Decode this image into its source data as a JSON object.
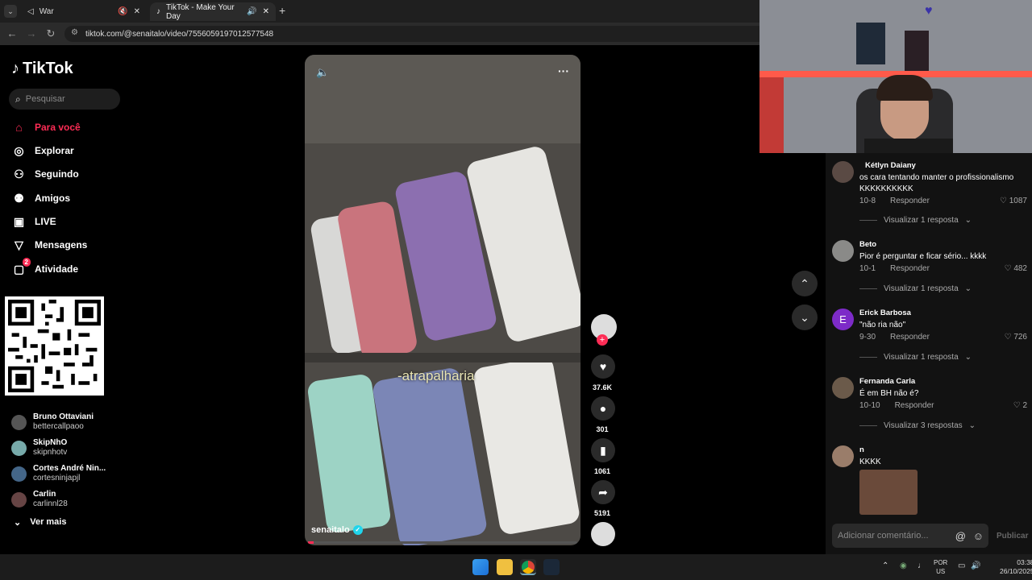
{
  "browser": {
    "tabs": [
      {
        "title": "War",
        "active": false
      },
      {
        "title": "TikTok - Make Your Day",
        "active": true
      }
    ],
    "url": "tiktok.com/@senaitalo/video/7556059197012577548"
  },
  "tiktok": {
    "logo_text": "TikTok",
    "search_placeholder": "Pesquisar",
    "nav": [
      {
        "label": "Para você",
        "icon": "home-icon"
      },
      {
        "label": "Explorar",
        "icon": "compass-icon"
      },
      {
        "label": "Seguindo",
        "icon": "following-icon"
      },
      {
        "label": "Amigos",
        "icon": "friends-icon"
      },
      {
        "label": "LIVE",
        "icon": "live-icon"
      },
      {
        "label": "Mensagens",
        "icon": "messages-icon"
      },
      {
        "label": "Atividade",
        "icon": "activity-icon",
        "badge": "2"
      }
    ],
    "accounts": [
      {
        "name": "Bruno Ottaviani",
        "handle": "bettercallpaoo"
      },
      {
        "name": "SkipNhO",
        "handle": "skipnhotv"
      },
      {
        "name": "Cortes André Nin...",
        "handle": "cortesninjapjl"
      },
      {
        "name": "Carlin",
        "handle": "carlinnl28"
      }
    ],
    "see_more": "Ver mais",
    "video": {
      "caption": "-atrapalharia",
      "author": "senaitalo",
      "likes": "37.6K",
      "comments": "301",
      "saves": "1061",
      "shares": "5191",
      "progress": 0.02
    },
    "comments": [
      {
        "user": "Kétlyn Daiany",
        "text": "os cara tentando manter o profissionalismo KKKKKKKKKK",
        "date": "10-8",
        "reply": "Responder",
        "likes": "1087",
        "replies": "Visualizar 1 resposta"
      },
      {
        "user": "Beto",
        "text": "Pior é perguntar e ficar sério... kkkk",
        "date": "10-1",
        "reply": "Responder",
        "likes": "482",
        "replies": "Visualizar 1 resposta"
      },
      {
        "user": "Erick Barbosa",
        "avatar_letter": "E",
        "text": "\"não ria não\"",
        "date": "9-30",
        "reply": "Responder",
        "likes": "726",
        "replies": "Visualizar 1 resposta"
      },
      {
        "user": "Fernanda Carla",
        "text": "É em BH não é?",
        "date": "10-10",
        "reply": "Responder",
        "likes": "2",
        "replies": "Visualizar 3 respostas"
      },
      {
        "user": "n",
        "text": "KKKK",
        "date": "",
        "reply": "",
        "likes": "",
        "replies": ""
      }
    ],
    "comment_placeholder": "Adicionar comentário...",
    "publish_label": "Publicar"
  },
  "taskbar": {
    "lang": "POR",
    "region": "US",
    "time": "03:38",
    "date": "26/10/2025"
  },
  "colors": {
    "accent": "#fe2c55",
    "bg": "#000000"
  }
}
